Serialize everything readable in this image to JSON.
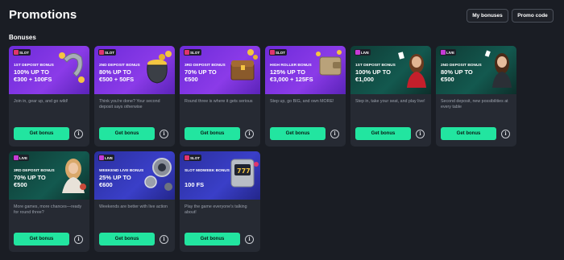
{
  "header": {
    "title": "Promotions",
    "my_bonuses_label": "My bonuses",
    "promo_code_label": "Promo code"
  },
  "section": {
    "title": "Bonuses"
  },
  "colors": {
    "accent": "#22e5a0",
    "slot_banner": "#7a32e0",
    "live_banner": "#13594f",
    "blue_banner": "#3a3fc8"
  },
  "cards": [
    {
      "badge": "SLOT",
      "sub": "1ST DEPOSIT BONUS",
      "main1": "100% UP TO",
      "main2": "€300 + 100FS",
      "desc": "Join in, gear up, and go wild!",
      "button": "Get bonus",
      "art": "horseshoe-icon"
    },
    {
      "badge": "SLOT",
      "sub": "2ND DEPOSIT BONUS",
      "main1": "80% UP TO",
      "main2": "€500 + 50FS",
      "desc": "Think you're done? Your second deposit says otherwise",
      "button": "Get bonus",
      "art": "pot-of-gold-icon"
    },
    {
      "badge": "SLOT",
      "sub": "3RD DEPOSIT BONUS",
      "main1": "70% UP TO",
      "main2": "€500",
      "desc": "Round three is where it gets serious",
      "button": "Get bonus",
      "art": "treasure-chest-icon"
    },
    {
      "badge": "SLOT",
      "sub": "HIGH ROLLER BONUS",
      "main1": "125% UP TO",
      "main2": "€3,000 + 125FS",
      "desc": "Step up, go BIG, and own MORE!",
      "button": "Get bonus",
      "art": "wallet-icon"
    },
    {
      "badge": "LIVE",
      "sub": "1ST DEPOSIT BONUS",
      "main1": "100% UP TO",
      "main2": "€1,000",
      "desc": "Step in, take your seat, and play live!",
      "button": "Get bonus",
      "art": "live-dealer-icon"
    },
    {
      "badge": "LIVE",
      "sub": "2ND DEPOSIT BONUS",
      "main1": "80% UP TO",
      "main2": "€500",
      "desc": "Second deposit, new possibilities at every table",
      "button": "Get bonus",
      "art": "live-dealer-icon"
    },
    {
      "badge": "LIVE",
      "sub": "3RD DEPOSIT BONUS",
      "main1": "70% UP TO",
      "main2": "€500",
      "desc": "More games, more chances—ready for round three?",
      "button": "Get bonus",
      "art": "live-dealer-icon"
    },
    {
      "badge": "LIVE",
      "sub": "WEEKEND LIVE BONUS",
      "main1": "25% UP TO",
      "main2": "€600",
      "desc": "Weekends are better with live action",
      "button": "Get bonus",
      "art": "chips-icon"
    },
    {
      "badge": "SLOT",
      "sub": "SLOT MIDWEEK BONUS",
      "main1": "",
      "main2": "100 FS",
      "desc": "Play the game everyone's talking about!",
      "button": "Get bonus",
      "art": "slot-machine-icon"
    }
  ]
}
